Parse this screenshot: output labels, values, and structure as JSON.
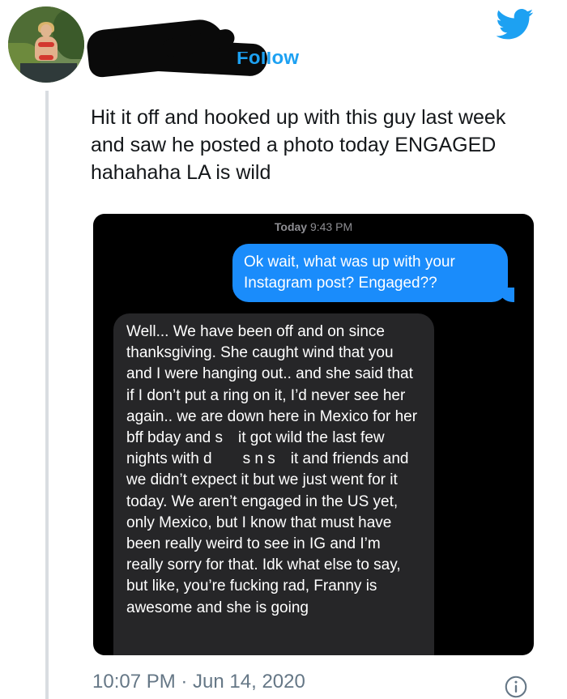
{
  "tweet": {
    "follow_label": "Follow",
    "text": "Hit it off and hooked up with this guy last week and saw he posted a photo today ENGAGED hahahaha LA is wild",
    "timestamp": "10:07 PM · Jun 14, 2020"
  },
  "screenshot": {
    "time_header_day": "Today",
    "time_header_time": "9:43 PM",
    "sent_message": "Ok wait, what was up with your Instagram post? Engaged??",
    "received_message": "Well... We have been off and on since thanksgiving. She caught wind that you and I were hanging out.. and she said that if I don’t put a ring on it, I’d never see her again.. we are down here in Mexico for her bff bday and s it got wild the last few nights with d  s n s it and friends and we didn’t expect it but we just went for it today. We aren’t engaged in the US yet, only Mexico, but I know that must have been really weird to see in IG and I’m really sorry for that. Idk what else to say, but like, you’re fucking rad, Franny is awesome and she is going"
  },
  "colors": {
    "twitter_blue": "#1da1f2",
    "imessage_blue": "#1a8cfb",
    "received_bubble": "#262628",
    "meta_gray": "#657786"
  },
  "icons": {
    "brand": "twitter-bird-icon",
    "info": "info-icon"
  }
}
